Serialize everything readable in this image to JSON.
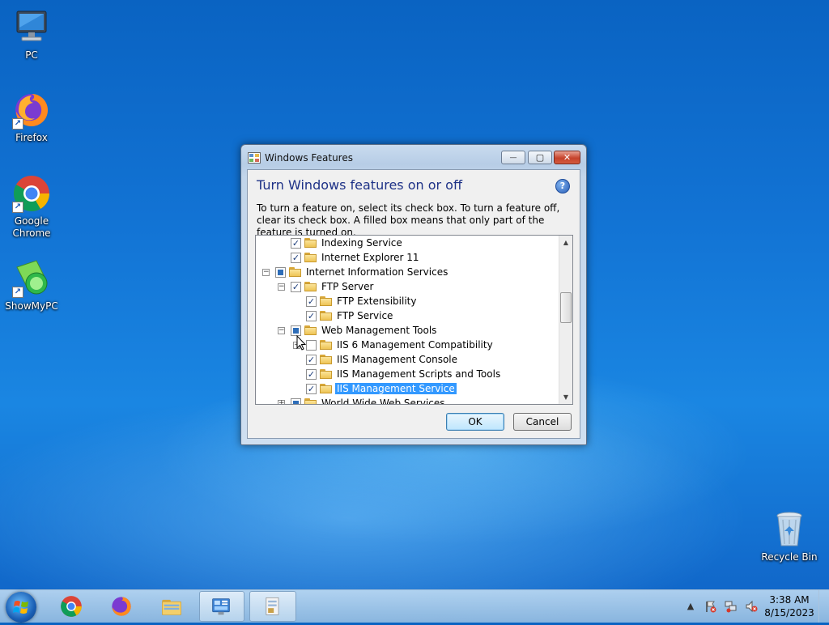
{
  "desktop": {
    "icons": [
      {
        "label_lines": [
          "PC"
        ],
        "icon": "computer-icon"
      },
      {
        "label_lines": [
          "Firefox"
        ],
        "icon": "firefox-icon"
      },
      {
        "label_lines": [
          "Google",
          "Chrome"
        ],
        "icon": "chrome-icon"
      },
      {
        "label_lines": [
          "ShowMyPC"
        ],
        "icon": "showmypc-icon"
      },
      {
        "label_lines": [
          "Recycle Bin"
        ],
        "icon": "recycle-bin-icon"
      }
    ]
  },
  "window": {
    "title": "Windows Features",
    "heading": "Turn Windows features on or off",
    "description": "To turn a feature on, select its check box. To turn a feature off, clear its check box. A filled box means that only part of the feature is turned on.",
    "help_glyph": "?",
    "controls": {
      "minimize": "—",
      "maximize": "▢",
      "close": "✕"
    },
    "tree": [
      {
        "label": "Indexing Service",
        "state": "checked",
        "expander": "none",
        "level": 1
      },
      {
        "label": "Internet Explorer 11",
        "state": "checked",
        "expander": "none",
        "level": 1
      },
      {
        "label": "Internet Information Services",
        "state": "partial",
        "expander": "−",
        "level": 0
      },
      {
        "label": "FTP Server",
        "state": "checked",
        "expander": "−",
        "level": 1
      },
      {
        "label": "FTP Extensibility",
        "state": "checked",
        "expander": "none",
        "level": 2
      },
      {
        "label": "FTP Service",
        "state": "checked",
        "expander": "none",
        "level": 2
      },
      {
        "label": "Web Management Tools",
        "state": "partial",
        "expander": "−",
        "level": 1
      },
      {
        "label": "IIS 6 Management Compatibility",
        "state": "unchecked",
        "expander": "+",
        "level": 2
      },
      {
        "label": "IIS Management Console",
        "state": "checked",
        "expander": "none",
        "level": 2
      },
      {
        "label": "IIS Management Scripts and Tools",
        "state": "checked",
        "expander": "none",
        "level": 2
      },
      {
        "label": "IIS Management Service",
        "state": "checked",
        "expander": "none",
        "level": 2,
        "selected": true
      },
      {
        "label": "World Wide Web Services",
        "state": "partial",
        "expander": "+",
        "level": 1
      }
    ],
    "scroll_arrows": {
      "up": "▲",
      "down": "▼"
    },
    "ok_label": "OK",
    "cancel_label": "Cancel"
  },
  "taskbar": {
    "apps": [
      {
        "name": "chrome",
        "icon": "chrome-icon",
        "active": false
      },
      {
        "name": "firefox",
        "icon": "firefox-icon",
        "active": false
      },
      {
        "name": "file-explorer",
        "icon": "folder-icon",
        "active": false
      },
      {
        "name": "control-panel",
        "icon": "control-panel-icon",
        "active": true
      },
      {
        "name": "windows-features",
        "icon": "windows-features-icon",
        "active": true
      }
    ],
    "tray_icons": [
      "show-hidden-icons-icon",
      "action-center-flag-icon",
      "network-icon",
      "volume-muted-icon"
    ],
    "time": "3:38 AM",
    "date": "8/15/2023"
  },
  "colors": {
    "desktop_blue": "#1273d4",
    "heading_blue": "#1e3287",
    "selection": "#3399ff"
  }
}
